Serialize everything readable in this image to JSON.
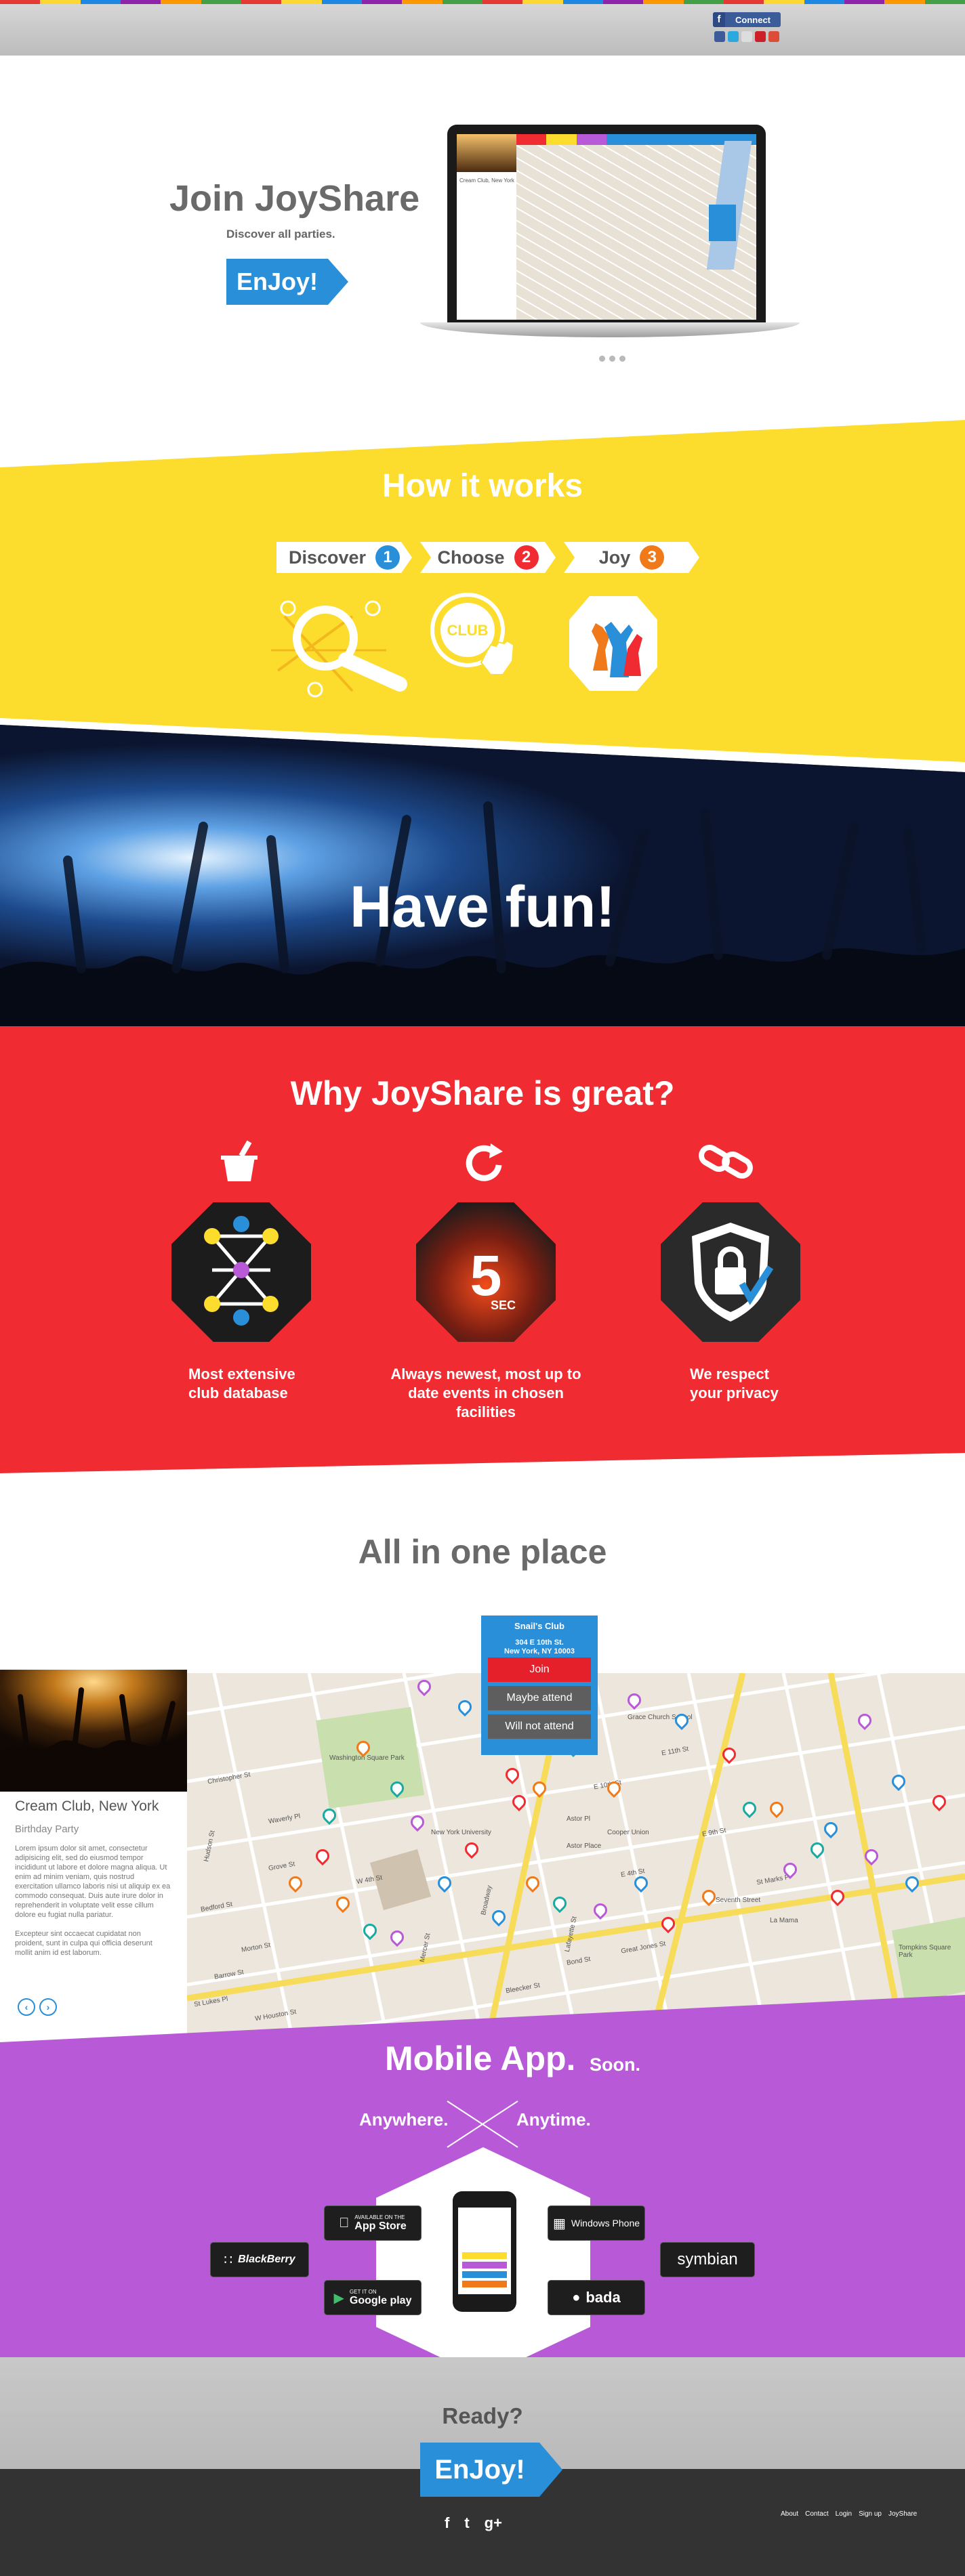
{
  "colors": {
    "blue": "#2a8fd9",
    "yellow": "#fcdd2d",
    "red": "#f02b32",
    "purple": "#b85ad8",
    "dark": "#333333",
    "stripe": [
      "#e53935",
      "#fdd835",
      "#1e88e5",
      "#8e24aa",
      "#ff9800",
      "#43a047",
      "#e53935",
      "#fdd835",
      "#1e88e5",
      "#8e24aa",
      "#ff9800",
      "#43a047",
      "#e53935",
      "#fdd835",
      "#1e88e5",
      "#8e24aa",
      "#ff9800",
      "#43a047",
      "#e53935",
      "#fdd835",
      "#1e88e5",
      "#8e24aa",
      "#ff9800",
      "#43a047"
    ]
  },
  "header": {
    "fb_connect": "Connect",
    "fb_icon": "f",
    "social_icons": [
      "facebook-icon",
      "twitter-icon",
      "email-icon",
      "pinterest-icon",
      "google-plus-icon"
    ]
  },
  "hero": {
    "title": "Join JoyShare",
    "subtitle": "Discover all parties.",
    "cta": "EnJoy!",
    "laptop_card_title": "Cream Club, New York"
  },
  "how": {
    "title": "How it works",
    "steps": [
      {
        "label": "Discover",
        "num": "1",
        "color": "#2a8fd9"
      },
      {
        "label": "Choose",
        "num": "2",
        "color": "#f02b32"
      },
      {
        "label": "Joy",
        "num": "3",
        "color": "#f07a1a"
      }
    ],
    "club_badge": "CLUB"
  },
  "fun": {
    "title": "Have fun!"
  },
  "why": {
    "title": "Why JoyShare is great?",
    "features": [
      {
        "label1": "Most extensive",
        "label2": "club database",
        "icon": "champagne-bucket-icon"
      },
      {
        "label1": "Always newest, most up to",
        "label2": "date events in chosen facilities",
        "icon": "refresh-icon",
        "timer": "5",
        "timer_unit": "SEC"
      },
      {
        "label1": "We respect",
        "label2": "your privacy",
        "icon": "link-icon"
      }
    ]
  },
  "aio": {
    "title": "All in one place",
    "card": {
      "title": "Cream Club, New York",
      "subtitle": "Birthday Party",
      "p1": "Lorem ipsum dolor sit amet, consectetur adipisicing elit, sed do eiusmod tempor incididunt ut labore et dolore magna aliqua. Ut enim ad minim veniam, quis nostrud exercitation ullamco laboris nisi ut aliquip ex ea commodo consequat. Duis aute irure dolor in reprehenderit in voluptate velit esse cillum dolore eu fugiat nulla pariatur.",
      "p2": "Excepteur sint occaecat cupidatat non proident, sunt in culpa qui officia deserunt mollit anim id est laborum.",
      "prev": "‹",
      "next": "›"
    },
    "popup": {
      "name": "Snail's Club",
      "address1": "304 E 10th St.",
      "address2": "New York, NY 10003",
      "join": "Join",
      "maybe": "Maybe attend",
      "not": "Will not attend"
    },
    "streets": [
      "Washington Square Park",
      "W 4th St",
      "Bleecker St",
      "E 10th St",
      "E 9th St",
      "St Marks Pl",
      "Broadway",
      "Lafayette St",
      "W Houston St",
      "Astor Pl",
      "Hudson St",
      "Christopher St",
      "Waverly Pl",
      "Great Jones St",
      "Grace Church School",
      "Tompkins Square Park",
      "Seventh Street",
      "Bond St",
      "E 4th St",
      "E 11th St",
      "Mercer St",
      "Morton St",
      "Bedford St",
      "Barrow St",
      "St Lukes Pl",
      "Grove St",
      "New York University",
      "Cooper Union",
      "La Mama",
      "Astor Place"
    ]
  },
  "mobile": {
    "title": "Mobile App.",
    "soon": "Soon.",
    "anywhere": "Anywhere.",
    "anytime": "Anytime.",
    "stores": {
      "appstore_small": "AVAILABLE ON THE",
      "appstore": "App Store",
      "google_small": "GET IT ON",
      "google": "Google play",
      "windows": "Windows Phone",
      "blackberry": "BlackBerry",
      "bada": "bada",
      "symbian": "symbian"
    }
  },
  "footer": {
    "ready": "Ready?",
    "cta": "EnJoy!",
    "social": [
      "f",
      "t",
      "g+"
    ],
    "links": [
      "About",
      "Contact",
      "Login",
      "Sign up",
      "JoyShare"
    ]
  }
}
